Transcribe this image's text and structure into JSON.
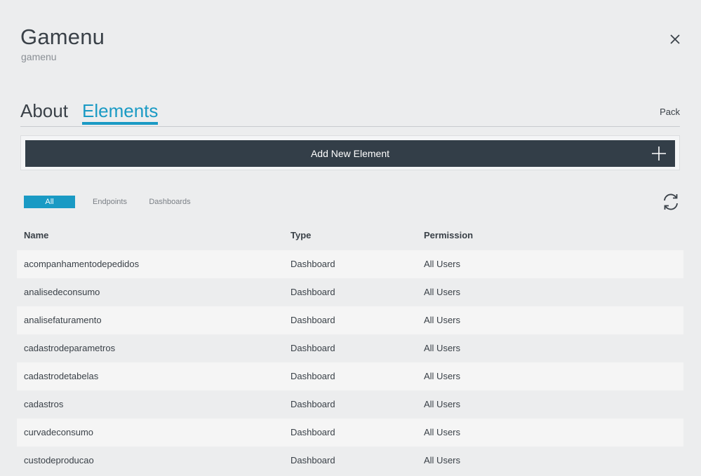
{
  "header": {
    "title": "Gamenu",
    "subtitle": "gamenu"
  },
  "tabs": [
    {
      "label": "About",
      "active": false
    },
    {
      "label": "Elements",
      "active": true
    }
  ],
  "pack_link": "Pack",
  "add_button": {
    "label": "Add New Element"
  },
  "filters": [
    {
      "label": "All",
      "active": true
    },
    {
      "label": "Endpoints",
      "active": false
    },
    {
      "label": "Dashboards",
      "active": false
    }
  ],
  "table": {
    "columns": [
      "Name",
      "Type",
      "Permission"
    ],
    "rows": [
      {
        "name": "acompanhamentodepedidos",
        "type": "Dashboard",
        "permission": "All Users"
      },
      {
        "name": "analisedeconsumo",
        "type": "Dashboard",
        "permission": "All Users"
      },
      {
        "name": "analisefaturamento",
        "type": "Dashboard",
        "permission": "All Users"
      },
      {
        "name": "cadastrodeparametros",
        "type": "Dashboard",
        "permission": "All Users"
      },
      {
        "name": "cadastrodetabelas",
        "type": "Dashboard",
        "permission": "All Users"
      },
      {
        "name": "cadastros",
        "type": "Dashboard",
        "permission": "All Users"
      },
      {
        "name": "curvadeconsumo",
        "type": "Dashboard",
        "permission": "All Users"
      },
      {
        "name": "custodeproducao",
        "type": "Dashboard",
        "permission": "All Users"
      }
    ]
  },
  "icons": {
    "close": "close-icon",
    "add": "plus-icon",
    "refresh": "refresh-icon"
  },
  "colors": {
    "accent": "#1a9ac4",
    "button_bg": "#333e48",
    "background": "#ecedee"
  }
}
